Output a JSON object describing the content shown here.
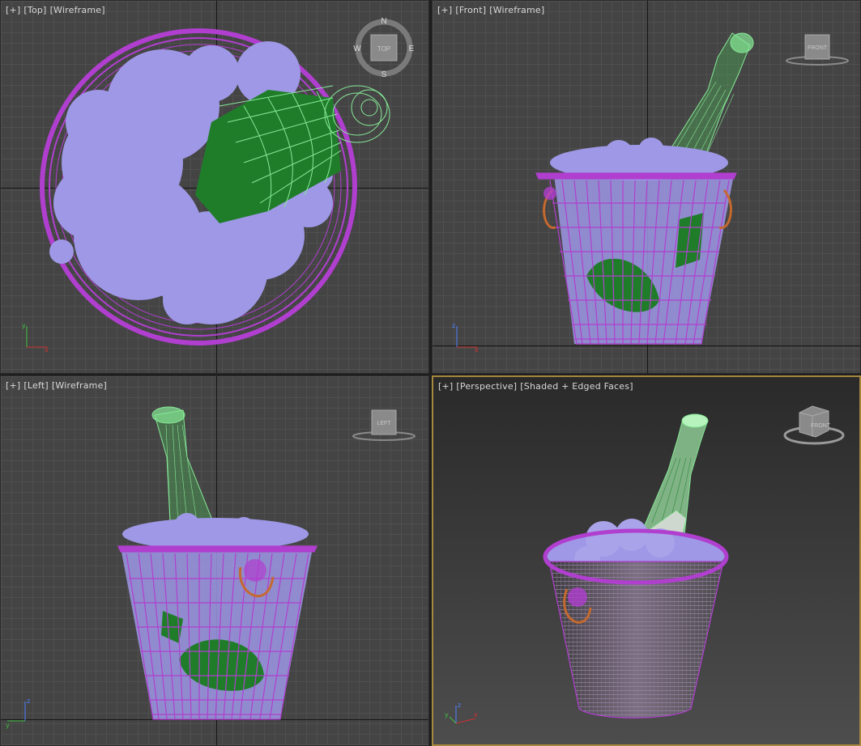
{
  "viewports": [
    {
      "id": "top",
      "menu": "[+]",
      "view": "[Top]",
      "shading": "[Wireframe]",
      "viewcube": {
        "face": "TOP",
        "north": "N",
        "south": "S",
        "east": "E",
        "west": "W"
      }
    },
    {
      "id": "front",
      "menu": "[+]",
      "view": "[Front]",
      "shading": "[Wireframe]",
      "viewcube": {
        "face": "FRONT"
      }
    },
    {
      "id": "left",
      "menu": "[+]",
      "view": "[Left]",
      "shading": "[Wireframe]",
      "viewcube": {
        "face": "LEFT"
      }
    },
    {
      "id": "perspective",
      "menu": "[+]",
      "view": "[Perspective]",
      "shading": "[Shaded + Edged Faces]",
      "viewcube": {
        "face": "FRONT"
      },
      "active": true
    }
  ],
  "colors": {
    "bucket": "#b03fcf",
    "ice": "#9e98e6",
    "bottle": "#86e896",
    "label": "#1f7d2a",
    "handle": "#c5692f",
    "viewport_bg": "#444444",
    "active_border": "#a6883e"
  },
  "gizmo": {
    "x": "x",
    "y": "y",
    "z": "z"
  }
}
